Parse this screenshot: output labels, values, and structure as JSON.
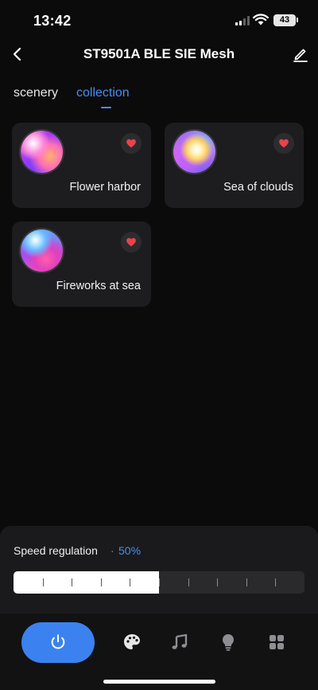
{
  "status_bar": {
    "time": "13:42",
    "battery": "43"
  },
  "header": {
    "title": "ST9501A BLE SIE Mesh",
    "back_icon": "chevron-left-icon",
    "edit_icon": "pencil-icon"
  },
  "tabs": [
    {
      "label": "scenery",
      "active": false
    },
    {
      "label": "collection",
      "active": true
    }
  ],
  "scenes": [
    {
      "name": "Flower harbor",
      "favorited": true
    },
    {
      "name": "Sea of clouds",
      "favorited": true
    },
    {
      "name": "Fireworks at sea",
      "favorited": true
    }
  ],
  "speed": {
    "label": "Speed regulation",
    "separator": "·",
    "value_text": "50%",
    "value": 0.5,
    "ticks": 9
  },
  "bottom_nav": [
    {
      "name": "power-button",
      "icon": "power-icon",
      "active": true
    },
    {
      "name": "palette",
      "icon": "palette-icon"
    },
    {
      "name": "music",
      "icon": "music-note-icon"
    },
    {
      "name": "bulb",
      "icon": "lightbulb-icon"
    },
    {
      "name": "grid",
      "icon": "grid-icon"
    }
  ],
  "colors": {
    "accent": "#3b82f0",
    "tab_active": "#4a8cf0",
    "heart": "#e8434b",
    "card": "#1d1d1f",
    "background": "#0b0b0c"
  }
}
